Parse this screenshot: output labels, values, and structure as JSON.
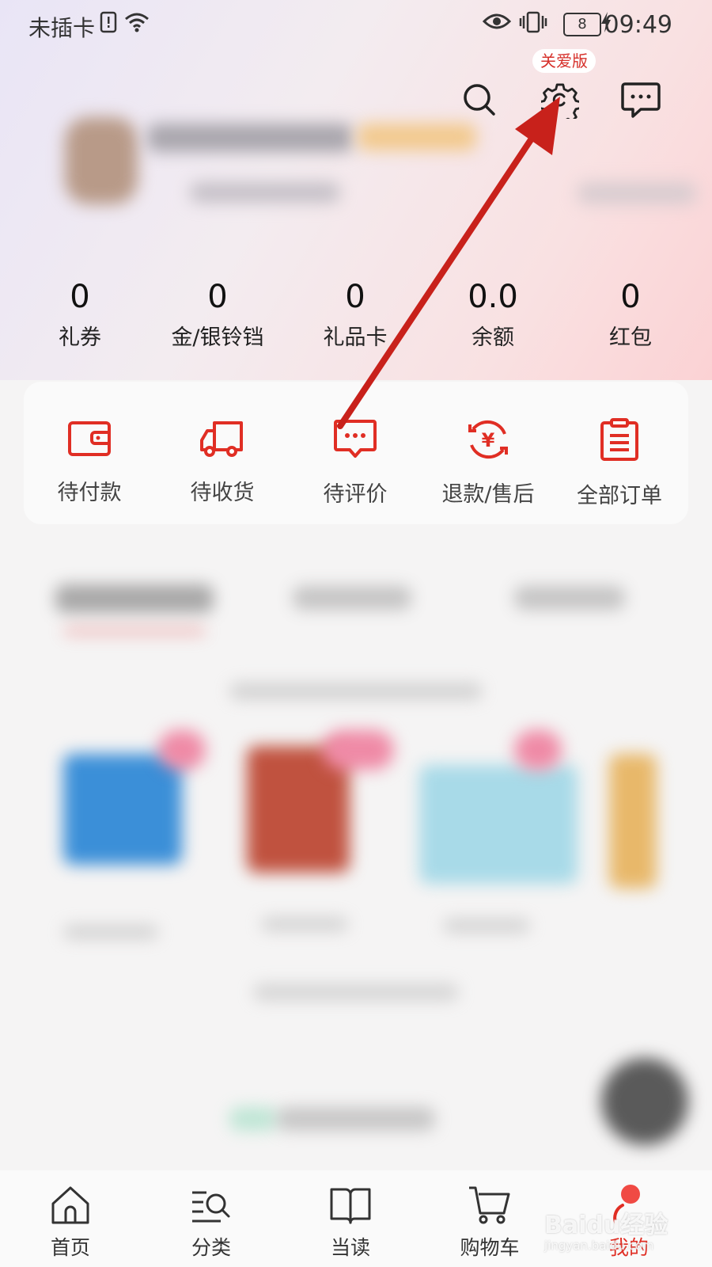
{
  "status_bar": {
    "carrier": "未插卡",
    "battery": "8",
    "time": "09:49"
  },
  "header": {
    "care_badge": "关爱版",
    "icons": [
      "search-icon",
      "gear-icon",
      "message-icon"
    ]
  },
  "stats": [
    {
      "value": "0",
      "label": "礼券"
    },
    {
      "value": "0",
      "label": "金/银铃铛"
    },
    {
      "value": "0",
      "label": "礼品卡"
    },
    {
      "value": "0.0",
      "label": "余额"
    },
    {
      "value": "0",
      "label": "红包"
    }
  ],
  "orders": [
    {
      "label": "待付款",
      "icon": "wallet-icon"
    },
    {
      "label": "待收货",
      "icon": "truck-icon"
    },
    {
      "label": "待评价",
      "icon": "comment-icon"
    },
    {
      "label": "退款/售后",
      "icon": "refund-icon"
    },
    {
      "label": "全部订单",
      "icon": "clipboard-icon"
    }
  ],
  "tabbar": [
    {
      "label": "首页",
      "icon": "home-icon"
    },
    {
      "label": "分类",
      "icon": "category-icon"
    },
    {
      "label": "当读",
      "icon": "book-icon"
    },
    {
      "label": "购物车",
      "icon": "cart-icon"
    },
    {
      "label": "我的",
      "icon": "profile-icon",
      "active": true
    }
  ],
  "watermark": {
    "text": "Baidu经验",
    "sub": "jingyan.baidu.com"
  },
  "colors": {
    "accent": "#e02e24",
    "annotation_arrow": "#c8211b"
  }
}
